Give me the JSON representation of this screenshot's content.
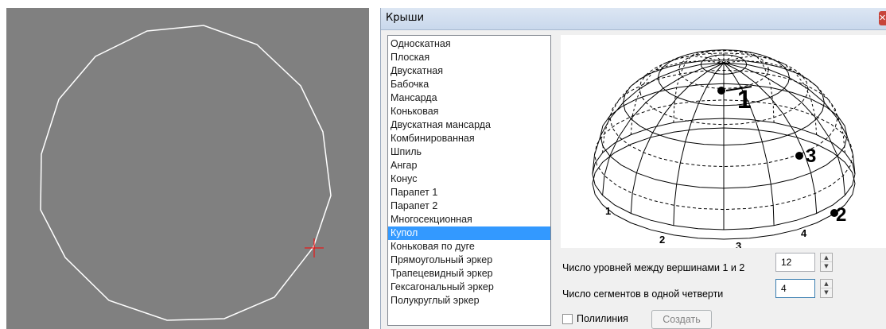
{
  "dialog": {
    "title": "Крыши",
    "close_icon": "close-icon"
  },
  "roof_types": [
    "Односкатная",
    "Плоская",
    "Двускатная",
    "Бабочка",
    "Мансарда",
    "Коньковая",
    "Двускатная мансарда",
    "Комбинированная",
    "Шпиль",
    "Ангар",
    "Конус",
    "Парапет 1",
    "Парапет 2",
    "Многосекционная",
    "Купол",
    "Коньковая по дуге",
    "Прямоугольный эркер",
    "Трапецевидный эркер",
    "Гексагональный эркер",
    "Полукруглый эркер"
  ],
  "selected_roof": "Купол",
  "preview": {
    "labels": [
      "1",
      "2",
      "3",
      "1",
      "2",
      "3",
      "4"
    ]
  },
  "params": {
    "levels_label": "Число уровней между вершинами 1 и 2",
    "levels_value": "12",
    "segments_label": "Число сегментов в одной четверти",
    "segments_value": "4"
  },
  "polyline_label": "Полилиния",
  "create_label": "Создать",
  "colors": {
    "viewport_bg": "#808080",
    "polygon_stroke": "#ffffff",
    "cursor": "#ff0000",
    "selection": "#3399ff"
  }
}
